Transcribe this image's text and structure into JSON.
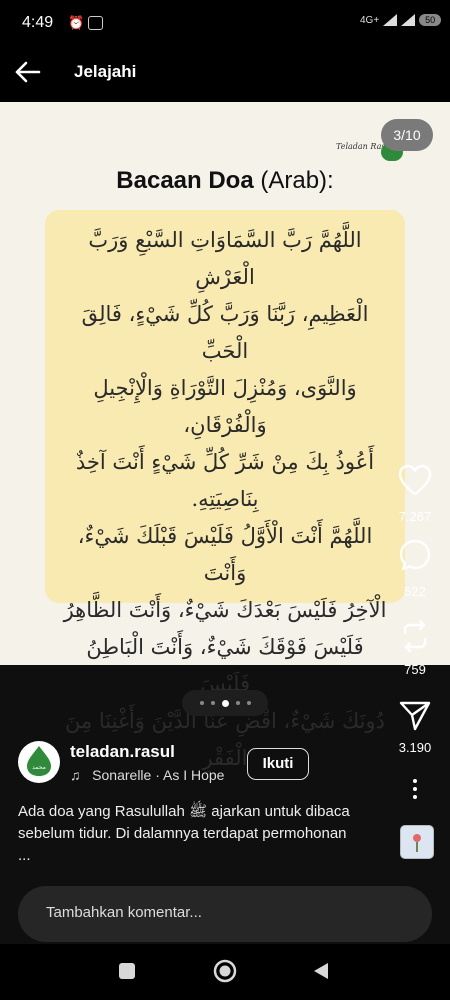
{
  "status_bar": {
    "time": "4:49",
    "network": "4G+",
    "battery": "50"
  },
  "header": {
    "title": "Jelajahi"
  },
  "post": {
    "page_indicator": "3/10",
    "signature": "Teladan Rasul",
    "heading_bold": "Bacaan Doa",
    "heading_rest": " (Arab):",
    "arabic_lines": [
      "اللَّهُمَّ رَبَّ السَّمَاوَاتِ السَّبْعِ وَرَبَّ الْعَرْشِ",
      "الْعَظِيمِ، رَبَّنَا وَرَبَّ كُلِّ شَيْءٍ، فَالِقَ الْحَبِّ",
      "وَالنَّوَى، وَمُنْزِلَ التَّوْرَاةِ وَالْإِنْجِيلِ وَالْفُرْقَانِ،",
      "أَعُوذُ بِكَ مِنْ شَرِّ كُلِّ شَيْءٍ أَنْتَ آخِذٌ",
      "بِنَاصِيَتِهِ.",
      "اللَّهُمَّ أَنْتَ الْأَوَّلُ فَلَيْسَ قَبْلَكَ شَيْءٌ، وَأَنْتَ",
      "الْآخِرُ فَلَيْسَ بَعْدَكَ شَيْءٌ، وَأَنْتَ الظَّاهِرُ",
      "فَلَيْسَ فَوْقَكَ شَيْءٌ، وَأَنْتَ الْبَاطِنُ فَلَيْسَ",
      "دُونَكَ شَيْءٌ، اقْضِ عَنَّا الدَّيْنَ وَأَغْنِنَا مِنَ الْفَقْرِ"
    ]
  },
  "actions": {
    "likes": "7.267",
    "comments": "522",
    "reposts": "759",
    "shares": "3.190"
  },
  "author": {
    "username": "teladan.rasul",
    "avatar_text": "محمد",
    "music": "Sonarelle · As I Hope",
    "follow_label": "Ikuti"
  },
  "caption": {
    "line1": "Ada doa yang Rasulullah ﷺ ajarkan untuk dibaca",
    "line2": "sebelum tidur. Di dalamnya terdapat permohonan",
    "line3": "..."
  },
  "comment_placeholder": "Tambahkan komentar...",
  "carousel": {
    "count": 5,
    "active": 2
  }
}
